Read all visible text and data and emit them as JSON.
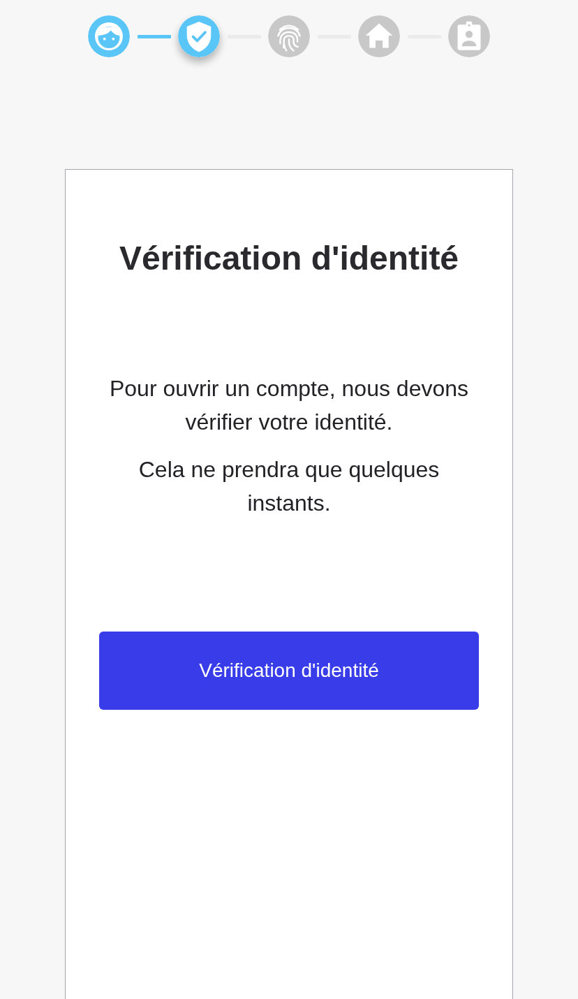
{
  "stepper": {
    "steps": [
      {
        "kind": "face",
        "active": true,
        "selected": false
      },
      {
        "kind": "shield",
        "active": true,
        "selected": true
      },
      {
        "kind": "fingerprint",
        "active": false,
        "selected": false
      },
      {
        "kind": "home",
        "active": false,
        "selected": false
      },
      {
        "kind": "badge",
        "active": false,
        "selected": false
      }
    ]
  },
  "card": {
    "title": "Vérification d'identité",
    "paragraphs": [
      "Pour ouvrir un compte, nous devons vérifier votre identité.",
      "Cela ne prendra que quelques instants."
    ],
    "button": "Vérification d'identité"
  }
}
